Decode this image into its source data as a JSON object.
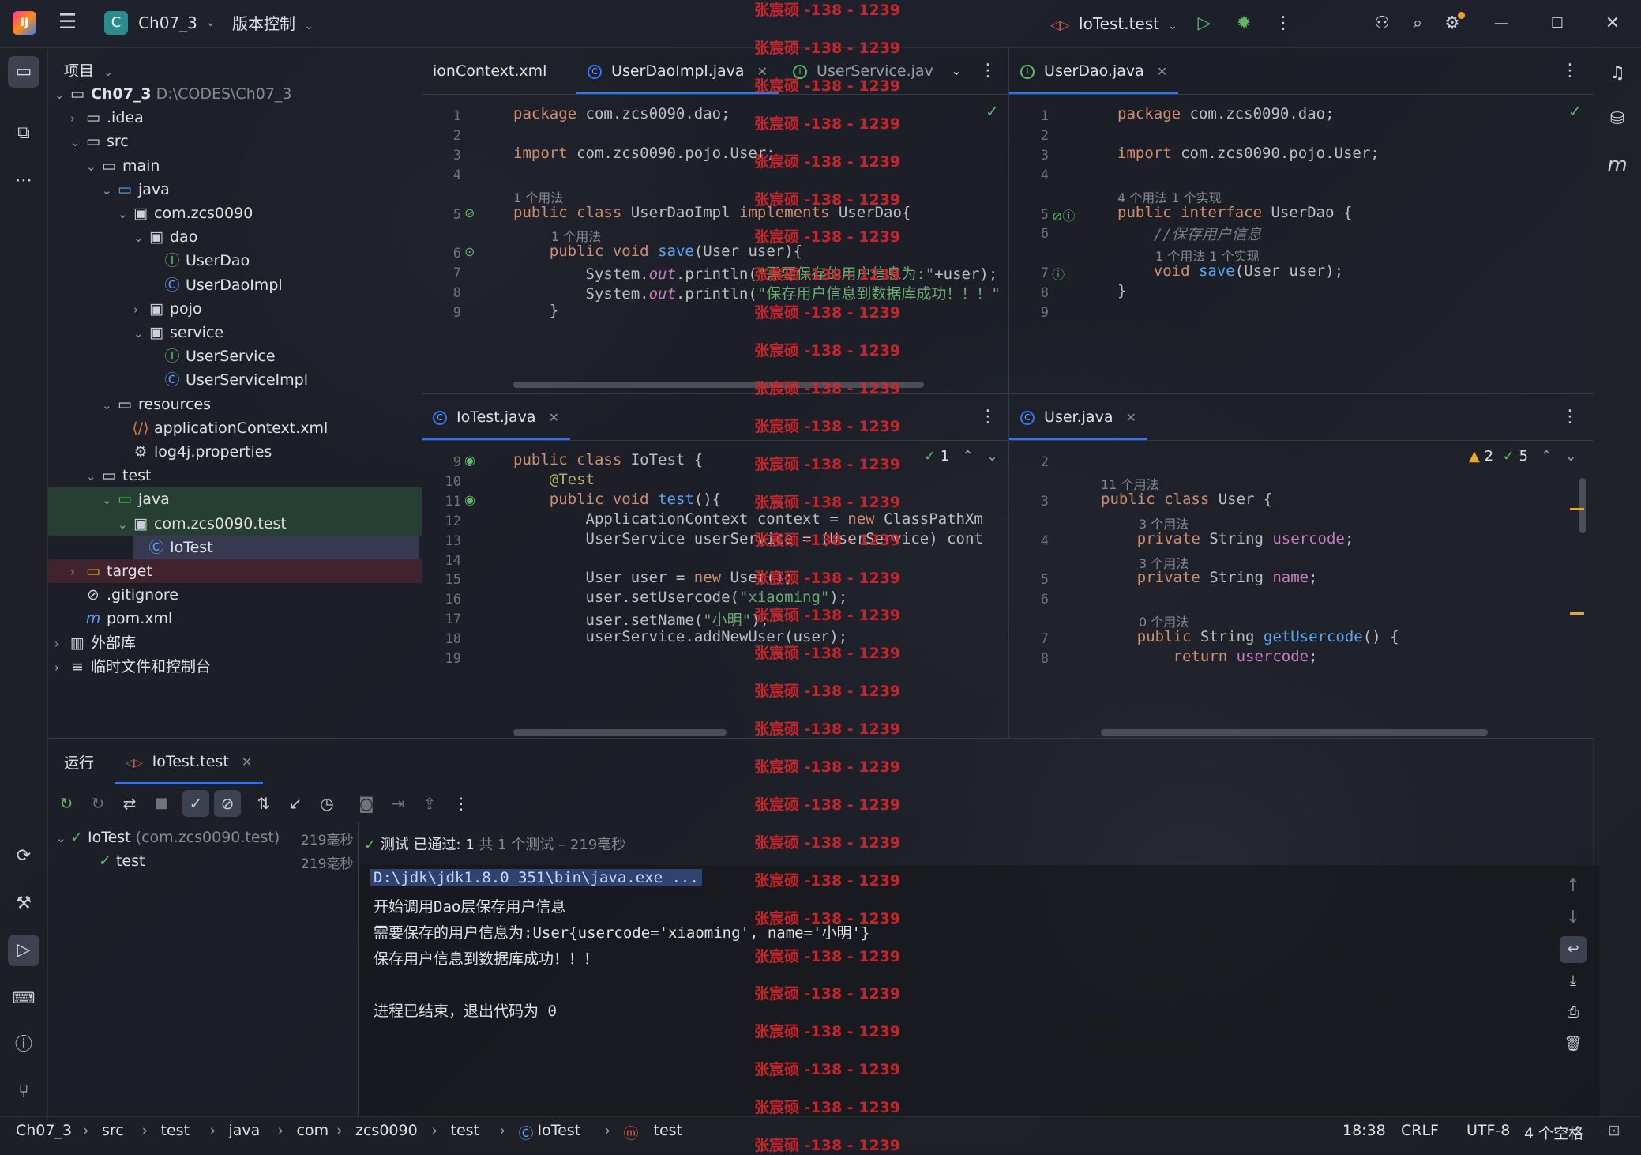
{
  "titlebar": {
    "project_badge": "C",
    "project_name": "Ch07_3",
    "vcs_label": "版本控制",
    "run_config": "IoTest.test"
  },
  "project_panel": {
    "title": "项目",
    "tree": [
      {
        "label": "Ch07_3",
        "path": "D:\\CODES\\Ch07_3",
        "depth": 0,
        "chev": "v",
        "icon": "folder"
      },
      {
        "label": ".idea",
        "depth": 1,
        "chev": ">",
        "icon": "folder"
      },
      {
        "label": "src",
        "depth": 1,
        "chev": "v",
        "icon": "folder"
      },
      {
        "label": "main",
        "depth": 2,
        "chev": "v",
        "icon": "folder"
      },
      {
        "label": "java",
        "depth": 3,
        "chev": "v",
        "icon": "folder-blue"
      },
      {
        "label": "com.zcs0090",
        "depth": 4,
        "chev": "v",
        "icon": "package"
      },
      {
        "label": "dao",
        "depth": 5,
        "chev": "v",
        "icon": "package"
      },
      {
        "label": "UserDao",
        "depth": 6,
        "chev": "",
        "icon": "interface"
      },
      {
        "label": "UserDaoImpl",
        "depth": 6,
        "chev": "",
        "icon": "class"
      },
      {
        "label": "pojo",
        "depth": 5,
        "chev": ">",
        "icon": "package"
      },
      {
        "label": "service",
        "depth": 5,
        "chev": "v",
        "icon": "package"
      },
      {
        "label": "UserService",
        "depth": 6,
        "chev": "",
        "icon": "interface"
      },
      {
        "label": "UserServiceImpl",
        "depth": 6,
        "chev": "",
        "icon": "class"
      },
      {
        "label": "resources",
        "depth": 3,
        "chev": "v",
        "icon": "folder"
      },
      {
        "label": "applicationContext.xml",
        "depth": 4,
        "chev": "",
        "icon": "xml"
      },
      {
        "label": "log4j.properties",
        "depth": 4,
        "chev": "",
        "icon": "gear"
      },
      {
        "label": "test",
        "depth": 2,
        "chev": "v",
        "icon": "folder"
      },
      {
        "label": "java",
        "depth": 3,
        "chev": "v",
        "icon": "folder-green"
      },
      {
        "label": "com.zcs0090.test",
        "depth": 4,
        "chev": "v",
        "icon": "package"
      },
      {
        "label": "IoTest",
        "depth": 5,
        "chev": "",
        "icon": "class"
      },
      {
        "label": "target",
        "depth": 1,
        "chev": ">",
        "icon": "folder-orange"
      },
      {
        "label": ".gitignore",
        "depth": 1,
        "chev": "",
        "icon": "ignore"
      },
      {
        "label": "pom.xml",
        "depth": 1,
        "chev": "",
        "icon": "maven"
      },
      {
        "label": "外部库",
        "depth": 0,
        "chev": ">",
        "icon": "library"
      },
      {
        "label": "临时文件和控制台",
        "depth": 0,
        "chev": ">",
        "icon": "scratch"
      }
    ]
  },
  "editors": {
    "top_left": {
      "tabs": [
        "ionContext.xml",
        "UserDaoImpl.java",
        "UserService.jav"
      ],
      "lines": [
        {
          "n": "1",
          "code": "package com.zcs0090.dao;"
        },
        {
          "n": "2",
          "code": ""
        },
        {
          "n": "3",
          "code": "import com.zcs0090.pojo.User;"
        },
        {
          "n": "4",
          "code": ""
        },
        {
          "n": "",
          "hint": "1 个用法"
        },
        {
          "n": "5",
          "code": "public class UserDaoImpl implements UserDao{"
        },
        {
          "n": "",
          "hint": "1 个用法"
        },
        {
          "n": "6",
          "code": "    public void save(User user){"
        },
        {
          "n": "7",
          "code": "        System.out.println(\"需要保存的用户信息为:\"+user);"
        },
        {
          "n": "8",
          "code": "        System.out.println(\"保存用户信息到数据库成功！！！\""
        },
        {
          "n": "9",
          "code": "    }"
        }
      ]
    },
    "top_right": {
      "tabs": [
        "UserDao.java"
      ],
      "lines": [
        {
          "n": "1",
          "code": "package com.zcs0090.dao;"
        },
        {
          "n": "2",
          "code": ""
        },
        {
          "n": "3",
          "code": "import com.zcs0090.pojo.User;"
        },
        {
          "n": "4",
          "code": ""
        },
        {
          "n": "",
          "hint": "4 个用法   1 个实现"
        },
        {
          "n": "5",
          "code": "public interface UserDao {"
        },
        {
          "n": "6",
          "code": "    //保存用户信息"
        },
        {
          "n": "",
          "hint": "1 个用法   1 个实现"
        },
        {
          "n": "7",
          "code": "    void save(User user);"
        },
        {
          "n": "8",
          "code": "}"
        },
        {
          "n": "9",
          "code": ""
        }
      ]
    },
    "bottom_left": {
      "tabs": [
        "IoTest.java"
      ],
      "inspection": "1",
      "lines": [
        {
          "n": "9",
          "code": "public class IoTest {"
        },
        {
          "n": "10",
          "code": "    @Test"
        },
        {
          "n": "11",
          "code": "    public void test(){"
        },
        {
          "n": "12",
          "code": "        ApplicationContext context = new ClassPathXm"
        },
        {
          "n": "13",
          "code": "        UserService userService = (UserService) cont"
        },
        {
          "n": "14",
          "code": ""
        },
        {
          "n": "15",
          "code": "        User user = new User();"
        },
        {
          "n": "16",
          "code": "        user.setUsercode(\"xiaoming\");"
        },
        {
          "n": "17",
          "code": "        user.setName(\"小明\");"
        },
        {
          "n": "18",
          "code": "        userService.addNewUser(user);"
        },
        {
          "n": "19",
          "code": ""
        }
      ]
    },
    "bottom_right": {
      "tabs": [
        "User.java"
      ],
      "warnings": "2",
      "checks": "5",
      "lines": [
        {
          "n": "2",
          "code": ""
        },
        {
          "n": "",
          "hint": "11 个用法"
        },
        {
          "n": "3",
          "code": "public class User {"
        },
        {
          "n": "",
          "hint": "3 个用法"
        },
        {
          "n": "4",
          "code": "    private String usercode;"
        },
        {
          "n": "",
          "hint": "3 个用法"
        },
        {
          "n": "5",
          "code": "    private String name;"
        },
        {
          "n": "6",
          "code": ""
        },
        {
          "n": "",
          "hint": "0 个用法"
        },
        {
          "n": "7",
          "code": "    public String getUsercode() {"
        },
        {
          "n": "8",
          "code": "        return usercode;"
        }
      ]
    }
  },
  "run_panel": {
    "title": "运行",
    "tab": "IoTest.test",
    "tree": [
      {
        "label": "IoTest",
        "sub": "(com.zcs0090.test)",
        "time": "219毫秒"
      },
      {
        "label": "test",
        "sub": "",
        "time": "219毫秒"
      }
    ],
    "status_pass": "测试 已通过: 1",
    "status_rest": "共 1 个测试 – 219毫秒",
    "console": [
      "D:\\jdk\\jdk1.8.0_351\\bin\\java.exe ...",
      "开始调用Dao层保存用户信息",
      "需要保存的用户信息为:User{usercode='xiaoming', name='小明'}",
      "保存用户信息到数据库成功！！！",
      "",
      "进程已结束，退出代码为 0"
    ]
  },
  "watermark": "张宸硕 -138 - 1239",
  "statusbar": {
    "breadcrumb": [
      "Ch07_3",
      "src",
      "test",
      "java",
      "com",
      "zcs0090",
      "test",
      "IoTest",
      "test"
    ],
    "position": "18:38",
    "line_sep": "CRLF",
    "encoding": "UTF-8",
    "indent": "4 个空格"
  },
  "colors": {
    "accent": "#3574f0",
    "pass": "#5fb865",
    "keyword": "#cf8e6d",
    "string": "#6aab73",
    "watermark": "#d8262c"
  }
}
